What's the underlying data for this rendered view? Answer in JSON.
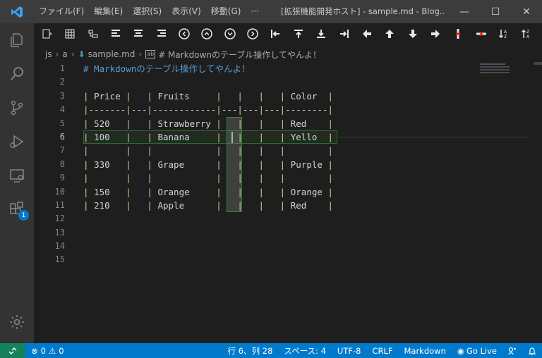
{
  "titlebar": {
    "menu": [
      "ファイル(F)",
      "編集(E)",
      "選択(S)",
      "表示(V)",
      "移動(G)",
      "···"
    ],
    "title": "[拡張機能開発ホスト] - sample.md - Blog...",
    "minimize": "—",
    "maximize": "☐",
    "close": "✕"
  },
  "activitybar": {
    "extensions_badge": "1"
  },
  "breadcrumb": {
    "items": [
      "js",
      "a",
      "sample.md",
      "# Markdownのテーブル操作してやんよ！"
    ]
  },
  "editor": {
    "line_numbers": [
      "1",
      "2",
      "3",
      "4",
      "5",
      "6",
      "7",
      "8",
      "9",
      "10",
      "11",
      "12",
      "13",
      "14",
      "15"
    ],
    "active_line_number": "6",
    "lines": [
      "# Markdownのテーブル操作してやんよ！",
      "",
      "| Price |   | Fruits     |   |   |   | Color  |",
      "|-------|---|------------|---|---|---|--------|",
      "| 520   |   | Strawberry |   |   |   | Red    |",
      "| 100   |   | Banana     |   |   |   | Yello  |",
      "|       |   |            |   |   |   |        |",
      "| 330   |   | Grape      |   |   |   | Purple |",
      "|       |   |            |   |   |   |        |",
      "| 150   |   | Orange     |   |   |   | Orange |",
      "| 210   |   | Apple      |   |   |   | Red    |",
      "",
      "",
      "",
      ""
    ]
  },
  "statusbar": {
    "errors": "0",
    "warnings": "0",
    "position": "行 6、列 28",
    "spaces": "スペース: 4",
    "encoding": "UTF-8",
    "eol": "CRLF",
    "language": "Markdown",
    "golive": "Go Live"
  },
  "colors": {
    "statusbar": "#007acc",
    "titlebar": "#3c3c3c",
    "activitybar": "#333333",
    "editor_bg": "#1e1e1e",
    "heading": "#569cd6",
    "pipe": "#e2c08d"
  }
}
